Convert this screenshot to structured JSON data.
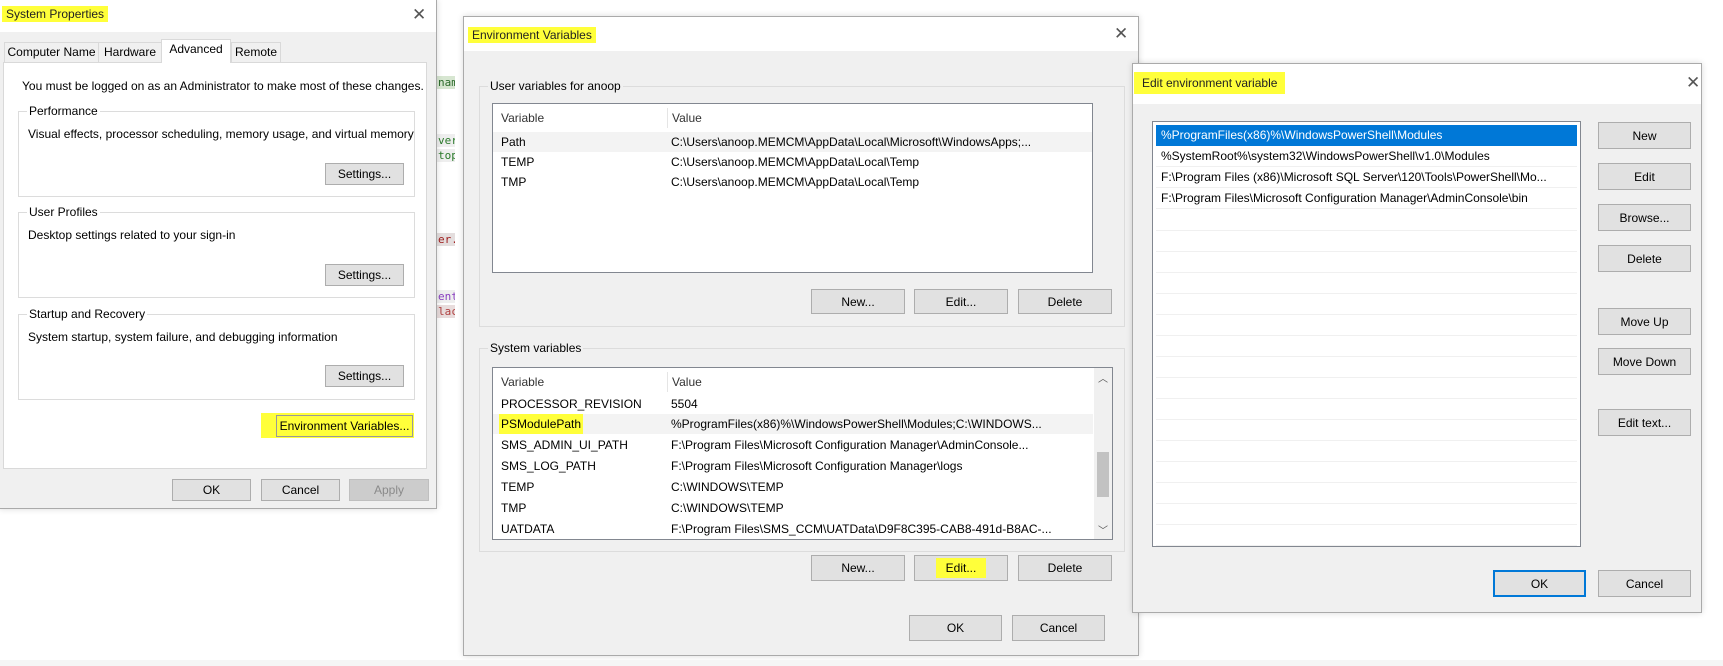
{
  "background_code": [
    "name",
    "ver",
    "top",
    "er.p",
    "ent",
    "lach"
  ],
  "system_properties": {
    "title": "System Properties",
    "tabs": [
      "Computer Name",
      "Hardware",
      "Advanced",
      "Remote"
    ],
    "selected_tab": "Advanced",
    "admin_note": "You must be logged on as an Administrator to make most of these changes.",
    "groups": [
      {
        "label": "Performance",
        "description": "Visual effects, processor scheduling, memory usage, and virtual memory",
        "button": "Settings..."
      },
      {
        "label": "User Profiles",
        "description": "Desktop settings related to your sign-in",
        "button": "Settings..."
      },
      {
        "label": "Startup and Recovery",
        "description": "System startup, system failure, and debugging information",
        "button": "Settings..."
      }
    ],
    "env_button": "Environment Variables...",
    "ok": "OK",
    "cancel": "Cancel",
    "apply": "Apply"
  },
  "environment_variables": {
    "title": "Environment Variables",
    "user_group": "User variables for anoop",
    "columns": [
      "Variable",
      "Value"
    ],
    "user_rows": [
      {
        "variable": "Path",
        "value": "C:\\Users\\anoop.MEMCM\\AppData\\Local\\Microsoft\\WindowsApps;..."
      },
      {
        "variable": "TEMP",
        "value": "C:\\Users\\anoop.MEMCM\\AppData\\Local\\Temp"
      },
      {
        "variable": "TMP",
        "value": "C:\\Users\\anoop.MEMCM\\AppData\\Local\\Temp"
      }
    ],
    "system_group": "System variables",
    "system_rows": [
      {
        "variable": "PROCESSOR_REVISION",
        "value": "5504"
      },
      {
        "variable": "PSModulePath",
        "value": "%ProgramFiles(x86)%\\WindowsPowerShell\\Modules;C:\\WINDOWS..."
      },
      {
        "variable": "SMS_ADMIN_UI_PATH",
        "value": "F:\\Program Files\\Microsoft Configuration Manager\\AdminConsole..."
      },
      {
        "variable": "SMS_LOG_PATH",
        "value": "F:\\Program Files\\Microsoft Configuration Manager\\logs"
      },
      {
        "variable": "TEMP",
        "value": "C:\\WINDOWS\\TEMP"
      },
      {
        "variable": "TMP",
        "value": "C:\\WINDOWS\\TEMP"
      },
      {
        "variable": "UATDATA",
        "value": "F:\\Program Files\\SMS_CCM\\UATData\\D9F8C395-CAB8-491d-B8AC-..."
      }
    ],
    "new": "New...",
    "edit": "Edit...",
    "delete": "Delete",
    "ok": "OK",
    "cancel": "Cancel"
  },
  "edit_variable": {
    "title": "Edit environment variable",
    "entries": [
      "%ProgramFiles(x86)%\\WindowsPowerShell\\Modules",
      "%SystemRoot%\\system32\\WindowsPowerShell\\v1.0\\Modules",
      "F:\\Program Files (x86)\\Microsoft SQL Server\\120\\Tools\\PowerShell\\Mo...",
      "F:\\Program Files\\Microsoft Configuration Manager\\AdminConsole\\bin"
    ],
    "selected_index": 0,
    "buttons": {
      "new": "New",
      "edit": "Edit",
      "browse": "Browse...",
      "delete": "Delete",
      "move_up": "Move Up",
      "move_down": "Move Down",
      "edit_text": "Edit text..."
    },
    "ok": "OK",
    "cancel": "Cancel"
  },
  "colors": {
    "highlight": "#ffff3a",
    "selection": "#0078d7"
  }
}
